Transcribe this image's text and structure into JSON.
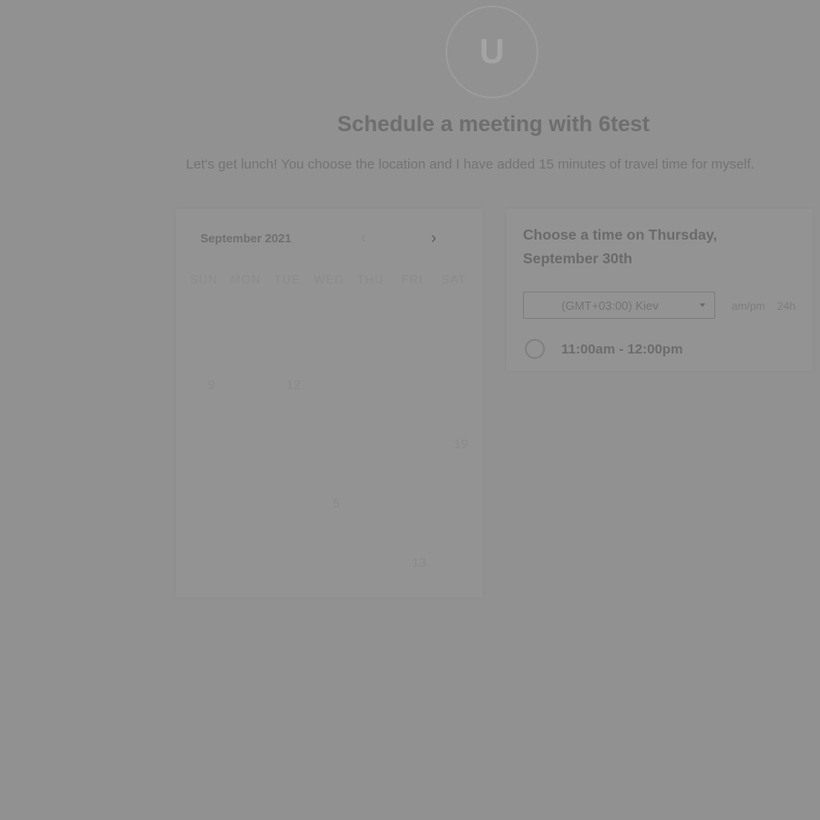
{
  "header": {
    "avatar_letter": "U",
    "title": "Schedule a meeting with 6test",
    "description": "Let's get lunch! You choose the location and I have added 15 minutes of travel time for myself."
  },
  "calendar": {
    "month_label": "September 2021",
    "prev_icon": "chevron-left-icon",
    "next_icon": "chevron-right-icon",
    "weekdays": [
      "SUN",
      "MON",
      "TUE",
      "WED",
      "THU",
      "FRI",
      "SAT"
    ],
    "days": {
      "d9": "9",
      "d12": "12",
      "d19": "19",
      "d5": "5",
      "d13": "13"
    }
  },
  "time_panel": {
    "title": "Choose a time on Thursday, September 30th",
    "timezone": "(GMT+03:00) Kiev",
    "format_ampm": "am/pm",
    "format_24h": "24h",
    "slots": [
      "11:00am - 12:00pm"
    ]
  },
  "colors": {
    "overlay": "#919191",
    "text_dark": "#6a6a6a"
  }
}
